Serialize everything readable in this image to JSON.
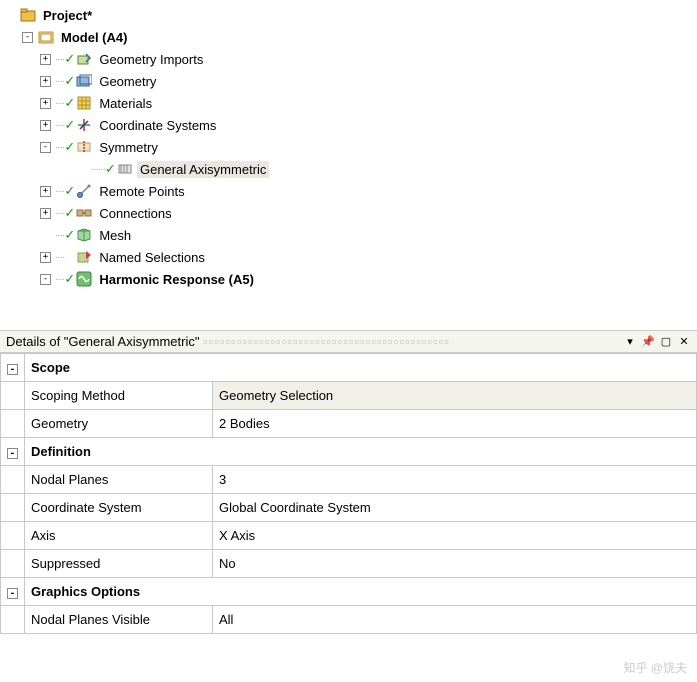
{
  "tree": {
    "root": "Project*",
    "model": "Model (A4)",
    "items": [
      {
        "label": "Geometry Imports",
        "exp": "+",
        "check": true,
        "icon": "geom-import"
      },
      {
        "label": "Geometry",
        "exp": "+",
        "check": true,
        "icon": "geometry"
      },
      {
        "label": "Materials",
        "exp": "+",
        "check": true,
        "icon": "materials"
      },
      {
        "label": "Coordinate Systems",
        "exp": "+",
        "check": true,
        "icon": "coord"
      },
      {
        "label": "Symmetry",
        "exp": "-",
        "check": true,
        "icon": "symmetry"
      },
      {
        "label": "General Axisymmetric",
        "exp": "",
        "check": true,
        "icon": "axisym",
        "child": true,
        "selected": true
      },
      {
        "label": "Remote Points",
        "exp": "+",
        "check": true,
        "icon": "remote"
      },
      {
        "label": "Connections",
        "exp": "+",
        "check": true,
        "icon": "connections"
      },
      {
        "label": "Mesh",
        "exp": "",
        "check": true,
        "icon": "mesh"
      },
      {
        "label": "Named Selections",
        "exp": "+",
        "check": false,
        "icon": "named"
      },
      {
        "label": "Harmonic Response (A5)",
        "exp": "-",
        "check": true,
        "icon": "harmonic",
        "bold": true
      }
    ]
  },
  "details": {
    "title": "Details of \"General Axisymmetric\"",
    "groups": [
      {
        "name": "Scope",
        "rows": [
          {
            "name": "Scoping Method",
            "value": "Geometry Selection",
            "editable": true
          },
          {
            "name": "Geometry",
            "value": "2 Bodies",
            "editable": false
          }
        ]
      },
      {
        "name": "Definition",
        "rows": [
          {
            "name": "Nodal Planes",
            "value": "3",
            "editable": false
          },
          {
            "name": "Coordinate System",
            "value": "Global Coordinate System",
            "editable": false
          },
          {
            "name": "Axis",
            "value": "X Axis",
            "editable": false
          },
          {
            "name": "Suppressed",
            "value": "No",
            "editable": false
          }
        ]
      },
      {
        "name": "Graphics Options",
        "rows": [
          {
            "name": "Nodal Planes Visible",
            "value": "All",
            "editable": false
          }
        ]
      }
    ]
  },
  "watermark": "知乎 @饶夫"
}
